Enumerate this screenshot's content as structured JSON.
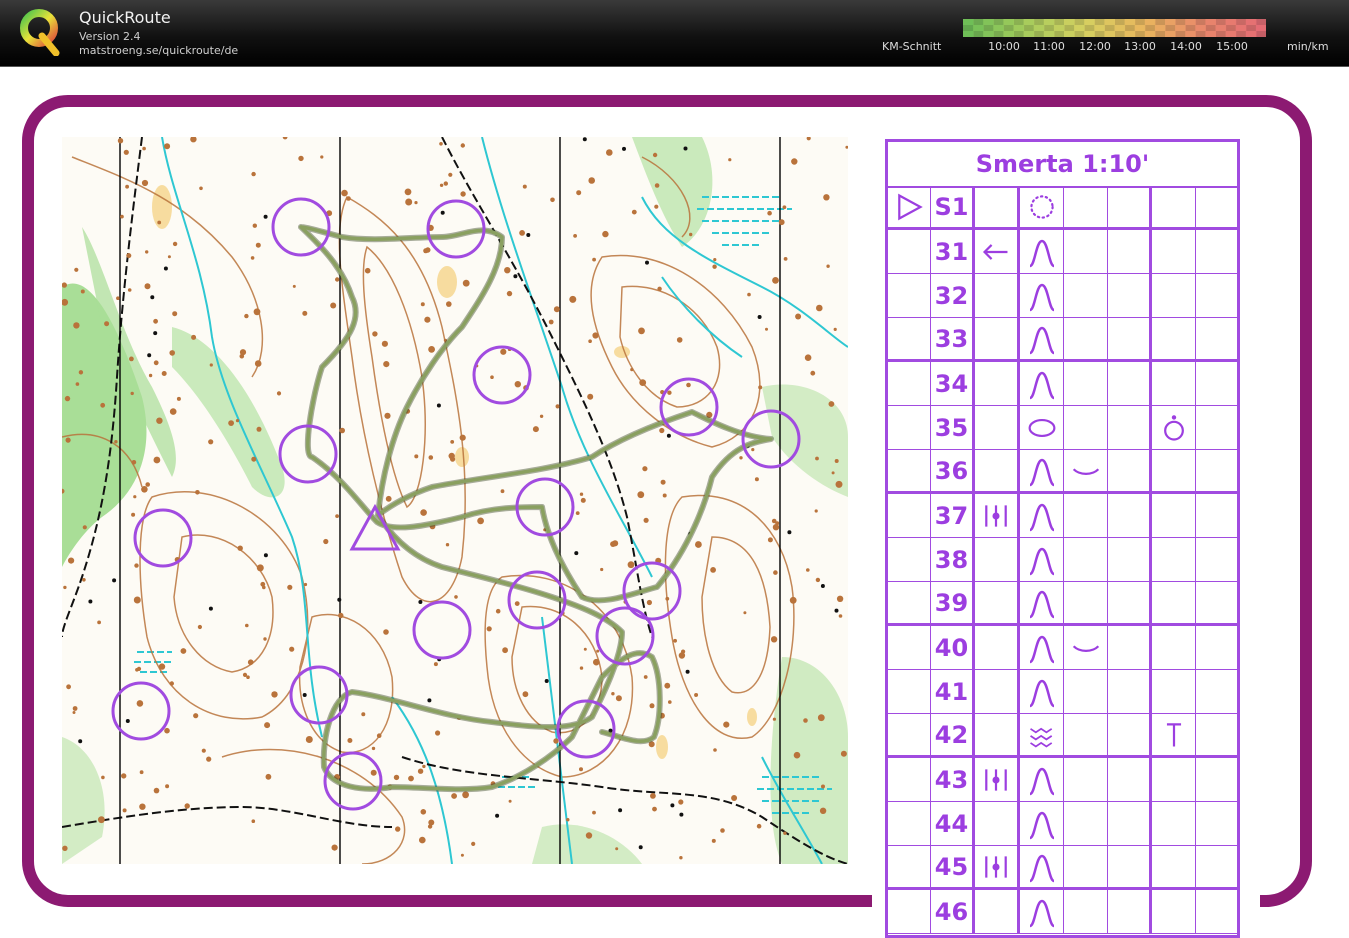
{
  "app": {
    "title": "QuickRoute",
    "version": "Version 2.4",
    "url": "matstroeng.se/quickroute/de"
  },
  "pace_legend": {
    "label": "KM-Schnitt",
    "ticks": [
      "10:00",
      "11:00",
      "12:00",
      "13:00",
      "14:00",
      "15:00"
    ],
    "unit": "min/km",
    "colors": [
      "#6fbf57",
      "#a6cc5c",
      "#d6d060",
      "#e9b65e",
      "#e9876b",
      "#e46c74"
    ]
  },
  "colors": {
    "frame": "#8c1a72",
    "course": "#a14be0",
    "route": "#7a8d58",
    "vegetation": "#8fd57d",
    "water": "#2ec7d2",
    "contour": "#b9733b"
  },
  "map": {
    "controls_count": 16
  },
  "control_descriptions": {
    "title": "Smerta 1:10'",
    "start": {
      "code": "S1",
      "symbol_a": "start-triangle-icon",
      "symbol_b": "dotted-circle-icon"
    },
    "rows": [
      {
        "code": "31",
        "which": "arrow-left",
        "feature": "knoll",
        "detail": "",
        "position": ""
      },
      {
        "code": "32",
        "which": "",
        "feature": "knoll",
        "detail": "",
        "position": ""
      },
      {
        "code": "33",
        "which": "",
        "feature": "knoll",
        "detail": "",
        "position": ""
      },
      {
        "code": "34",
        "which": "",
        "feature": "knoll",
        "detail": "",
        "position": ""
      },
      {
        "code": "35",
        "which": "",
        "feature": "oval",
        "detail": "",
        "position": "top"
      },
      {
        "code": "36",
        "which": "",
        "feature": "knoll",
        "detail": "arc",
        "position": ""
      },
      {
        "code": "37",
        "which": "middle",
        "feature": "knoll",
        "detail": "",
        "position": ""
      },
      {
        "code": "38",
        "which": "",
        "feature": "knoll",
        "detail": "",
        "position": ""
      },
      {
        "code": "39",
        "which": "",
        "feature": "knoll",
        "detail": "",
        "position": ""
      },
      {
        "code": "40",
        "which": "",
        "feature": "knoll",
        "detail": "arc",
        "position": ""
      },
      {
        "code": "41",
        "which": "",
        "feature": "knoll",
        "detail": "",
        "position": ""
      },
      {
        "code": "42",
        "which": "",
        "feature": "marsh",
        "detail": "",
        "position": "tee"
      },
      {
        "code": "43",
        "which": "middle",
        "feature": "knoll",
        "detail": "",
        "position": ""
      },
      {
        "code": "44",
        "which": "",
        "feature": "knoll",
        "detail": "",
        "position": ""
      },
      {
        "code": "45",
        "which": "middle",
        "feature": "knoll",
        "detail": "",
        "position": ""
      },
      {
        "code": "46",
        "which": "",
        "feature": "knoll",
        "detail": "",
        "position": ""
      }
    ]
  }
}
